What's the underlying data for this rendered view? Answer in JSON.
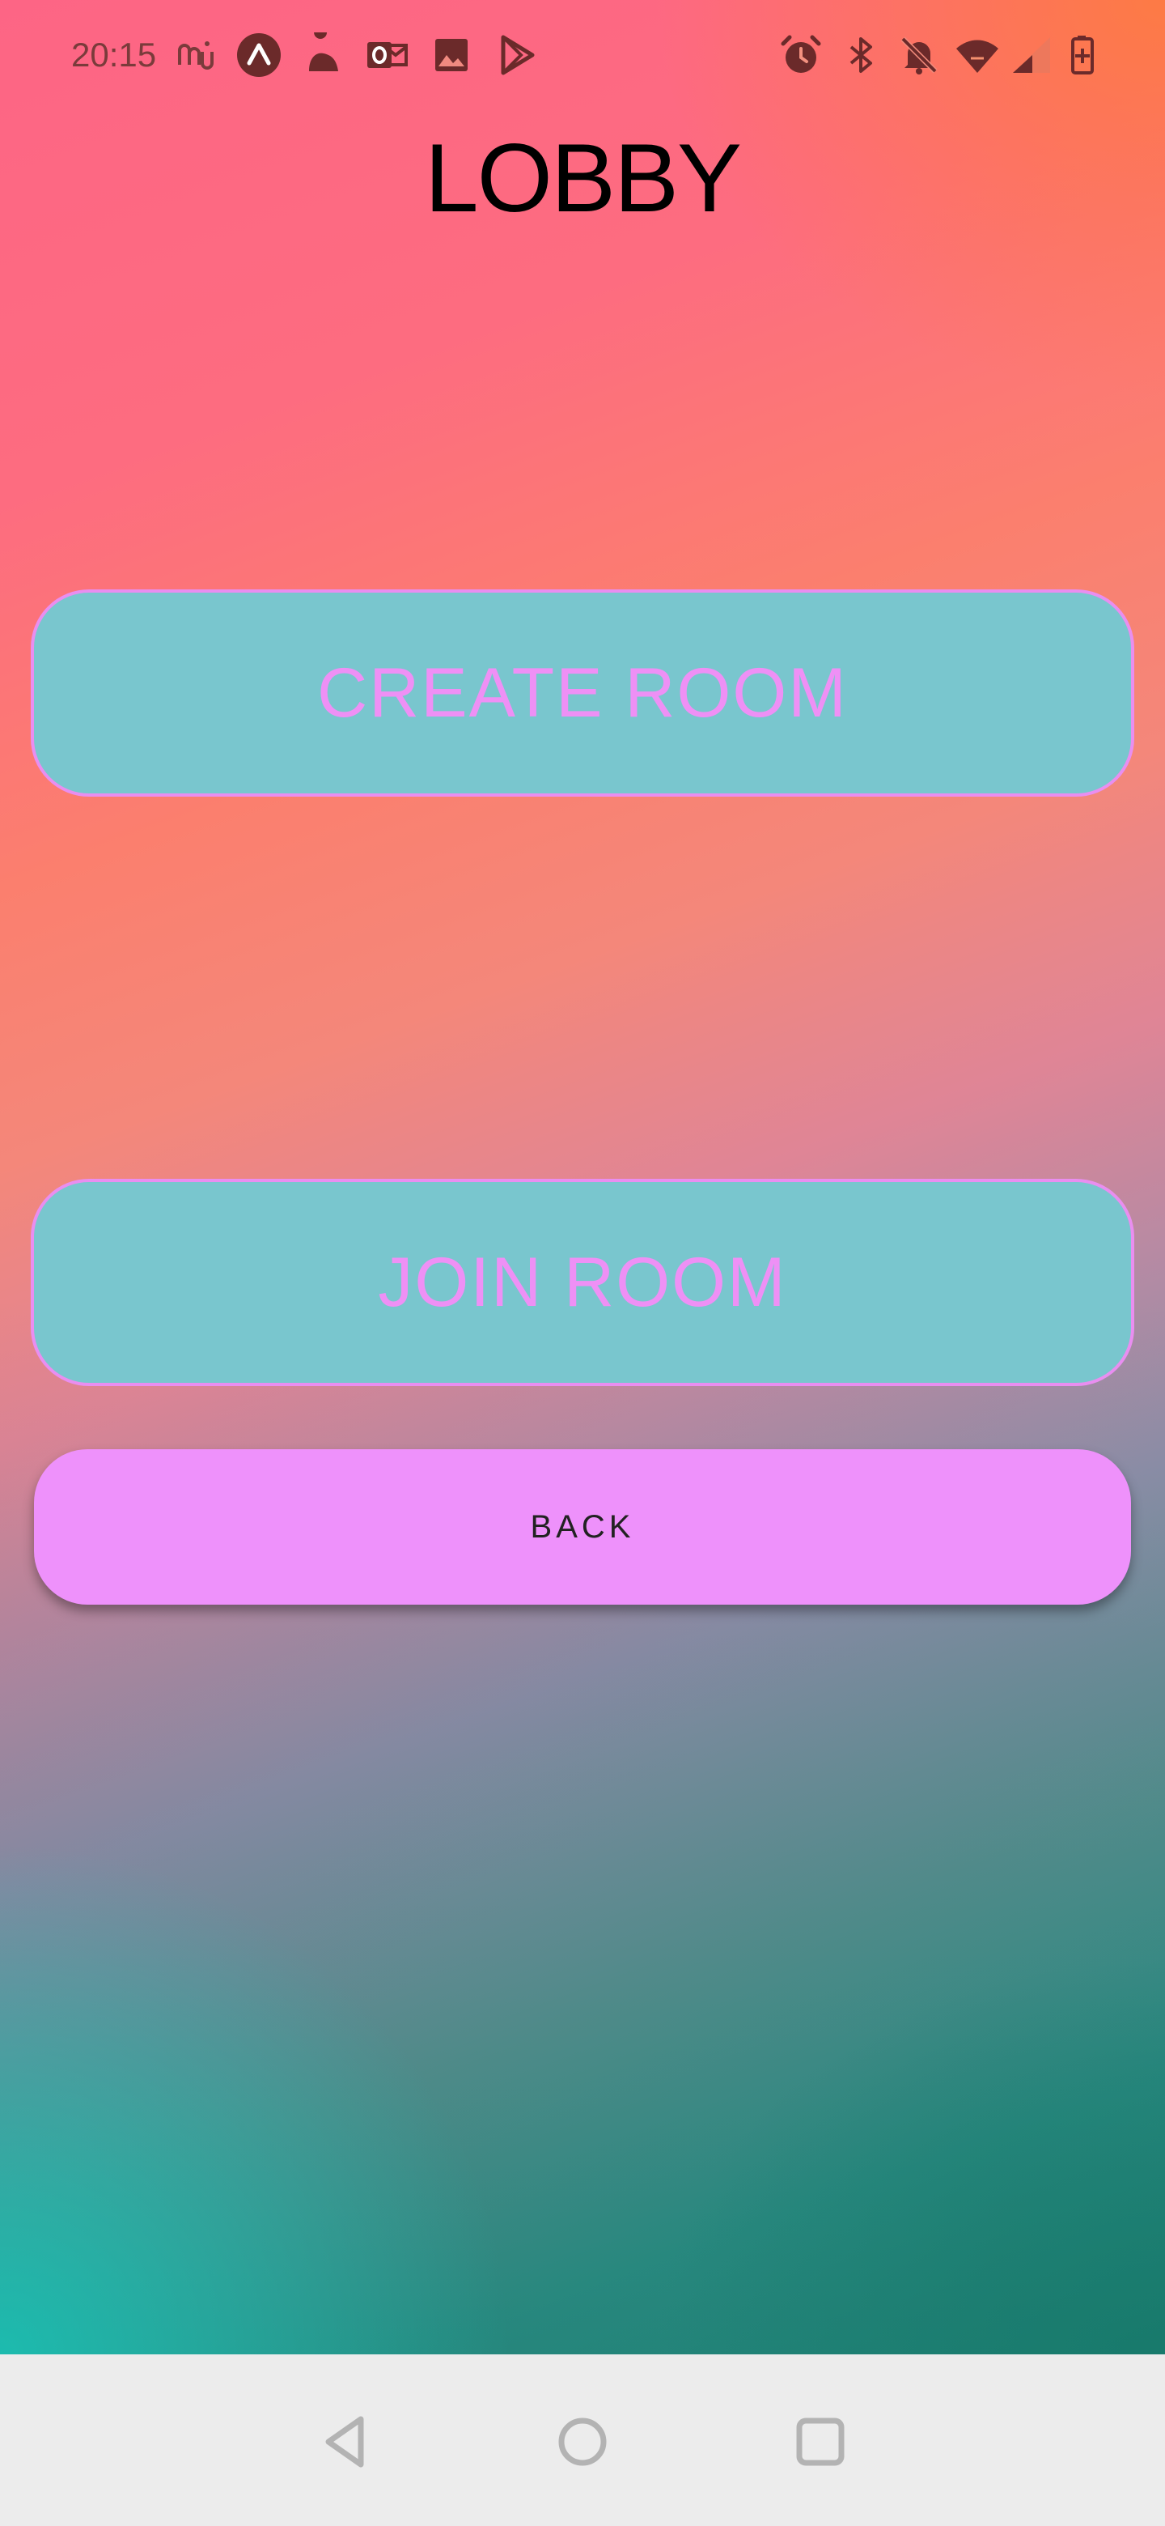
{
  "status_bar": {
    "time": "20:15",
    "left_icons": [
      "mi-fit-icon",
      "expo-icon",
      "duo-icon",
      "outlook-icon",
      "gallery-icon",
      "play-store-icon"
    ],
    "right_icons": [
      "alarm-icon",
      "bluetooth-icon",
      "bell-off-icon",
      "wifi-icon",
      "cellular-signal-icon",
      "battery-charging-icon"
    ]
  },
  "page": {
    "title": "LOBBY"
  },
  "buttons": {
    "create_room": "CREATE ROOM",
    "join_room": "JOIN ROOM",
    "back": "BACK"
  },
  "nav_bar": {
    "icons": [
      "nav-back-icon",
      "nav-home-icon",
      "nav-recents-icon"
    ]
  },
  "colors": {
    "room_button_bg": "#79c6ce",
    "room_button_text": "#ee90f5",
    "back_button_bg": "#ee91fb",
    "nav_bar_bg": "#ececec"
  }
}
